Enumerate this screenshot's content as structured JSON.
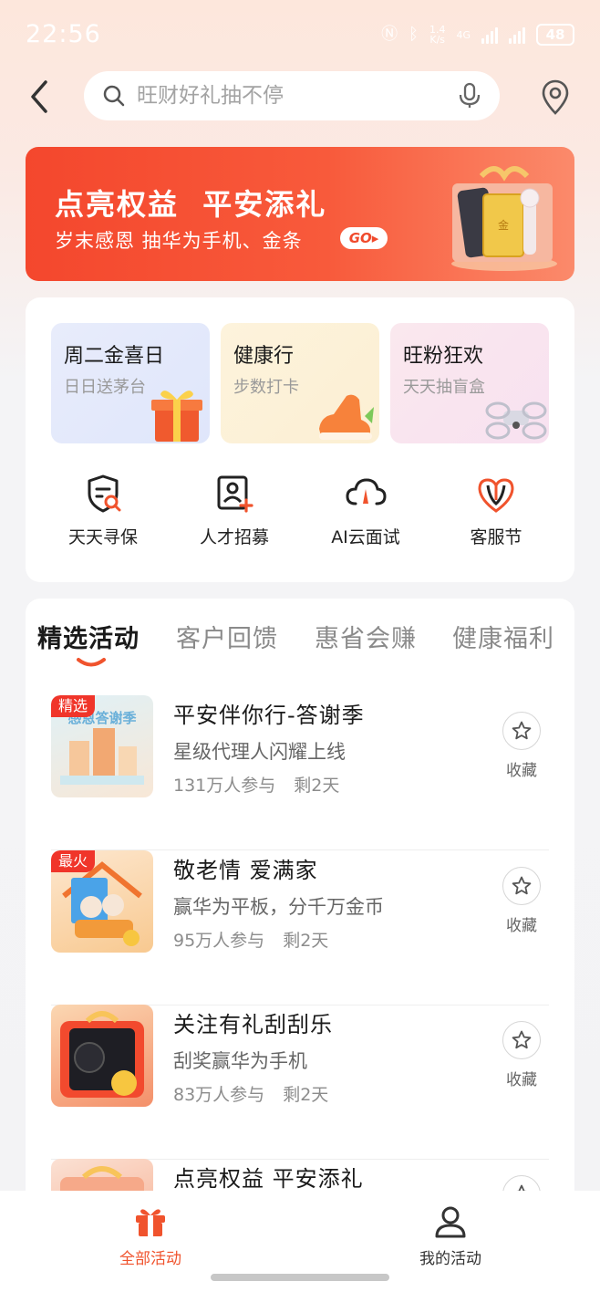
{
  "status_bar": {
    "time": "22:56",
    "speed_value": "1.4",
    "speed_unit": "K/s",
    "network": "4G",
    "battery": "48"
  },
  "search": {
    "placeholder": "旺财好礼抽不停"
  },
  "banner": {
    "title": "点亮权益  平安添礼",
    "subtitle": "岁末感恩  抽华为手机、金条",
    "go_label": "GO"
  },
  "promos": [
    {
      "title": "周二金喜日",
      "subtitle": "日日送茅台",
      "icon": "gift-box-icon"
    },
    {
      "title": "健康行",
      "subtitle": "步数打卡",
      "icon": "sneaker-icon"
    },
    {
      "title": "旺粉狂欢",
      "subtitle": "天天抽盲盒",
      "icon": "drone-icon"
    }
  ],
  "quick_icons": [
    {
      "label": "天天寻保",
      "icon": "shield-search-icon"
    },
    {
      "label": "人才招募",
      "icon": "recruit-icon"
    },
    {
      "label": "AI云面试",
      "icon": "cloud-interview-icon"
    },
    {
      "label": "客服节",
      "icon": "service-festival-icon"
    }
  ],
  "tabs": [
    "精选活动",
    "客户回馈",
    "惠省会赚",
    "健康福利"
  ],
  "active_tab": "精选活动",
  "activities": [
    {
      "badge": "精选",
      "title": "平安伴你行-答谢季",
      "subtitle": "星级代理人闪耀上线",
      "participants": "131万人参与",
      "remaining": "剩2天",
      "fav_label": "收藏"
    },
    {
      "badge": "最火",
      "title": "敬老情 爱满家",
      "subtitle": "赢华为平板，分千万金币",
      "participants": "95万人参与",
      "remaining": "剩2天",
      "fav_label": "收藏"
    },
    {
      "badge": "",
      "title": "关注有礼刮刮乐",
      "subtitle": "刮奖赢华为手机",
      "participants": "83万人参与",
      "remaining": "剩2天",
      "fav_label": "收藏"
    },
    {
      "badge": "",
      "title": "点亮权益 平安添礼",
      "subtitle": "",
      "participants": "",
      "remaining": "",
      "fav_label": ""
    }
  ],
  "bottom_nav": [
    {
      "label": "全部活动",
      "icon": "gift-box-icon",
      "active": true
    },
    {
      "label": "我的活动",
      "icon": "user-icon",
      "active": false
    }
  ],
  "colors": {
    "accent": "#f0532d",
    "badge": "#f0352a",
    "banner": "#f4472d"
  }
}
